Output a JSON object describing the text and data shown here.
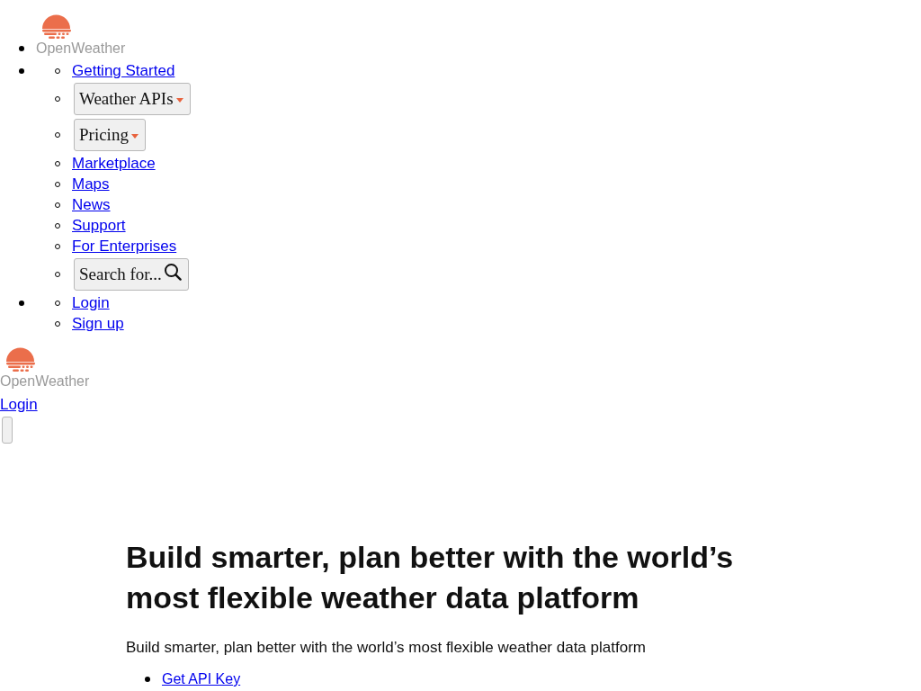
{
  "header_nav": {
    "logo": {
      "text": "OpenWeather"
    },
    "menu": [
      {
        "kind": "link",
        "label": "Getting Started"
      },
      {
        "kind": "dropdown",
        "label": "Weather APIs"
      },
      {
        "kind": "dropdown",
        "label": "Pricing"
      },
      {
        "kind": "link",
        "label": "Marketplace"
      },
      {
        "kind": "link",
        "label": "Maps"
      },
      {
        "kind": "link",
        "label": "News"
      },
      {
        "kind": "link",
        "label": "Support"
      },
      {
        "kind": "link",
        "label": "For Enterprises"
      },
      {
        "kind": "search",
        "label": "Search for..."
      }
    ],
    "account_links": [
      {
        "label": "Login"
      },
      {
        "label": "Sign up"
      }
    ]
  },
  "mobile_header": {
    "logo": {
      "text": "OpenWeather"
    },
    "login_link": "Login"
  },
  "hero": {
    "title": "Build smarter, plan better with the world’s most flexible weather data platform",
    "subtitle": "Build smarter, plan better with the world’s most flexible weather data platform",
    "actions": [
      {
        "label": "Get API Key"
      }
    ]
  }
}
